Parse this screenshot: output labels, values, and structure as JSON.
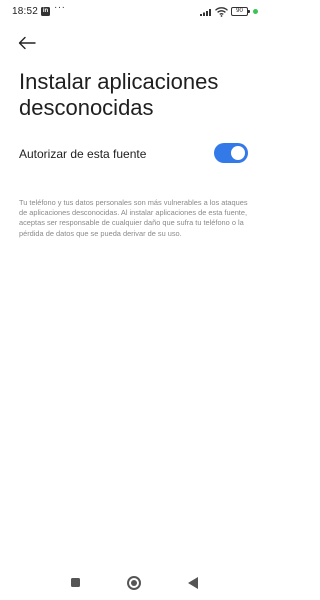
{
  "status_bar": {
    "time": "18:52",
    "app_badge": "in",
    "more": "···",
    "battery": "90",
    "dot_color": "#3ec25a"
  },
  "header": {
    "back_icon": "arrow-left-icon",
    "title": "Instalar aplicaciones desconocidas"
  },
  "setting": {
    "label": "Autorizar de esta fuente",
    "toggle_on": true,
    "accent_color": "#3479e8"
  },
  "description": "Tu teléfono y tus datos personales son más vulnerables a los ataques de aplicaciones desconocidas. Al instalar aplicaciones de esta fuente, aceptas ser responsable de cualquier daño que sufra tu teléfono o la pérdida de datos que se pueda derivar de su uso.",
  "nav_bar": {
    "recents_icon": "square-icon",
    "home_icon": "circle-icon",
    "back_icon": "triangle-back-icon"
  }
}
